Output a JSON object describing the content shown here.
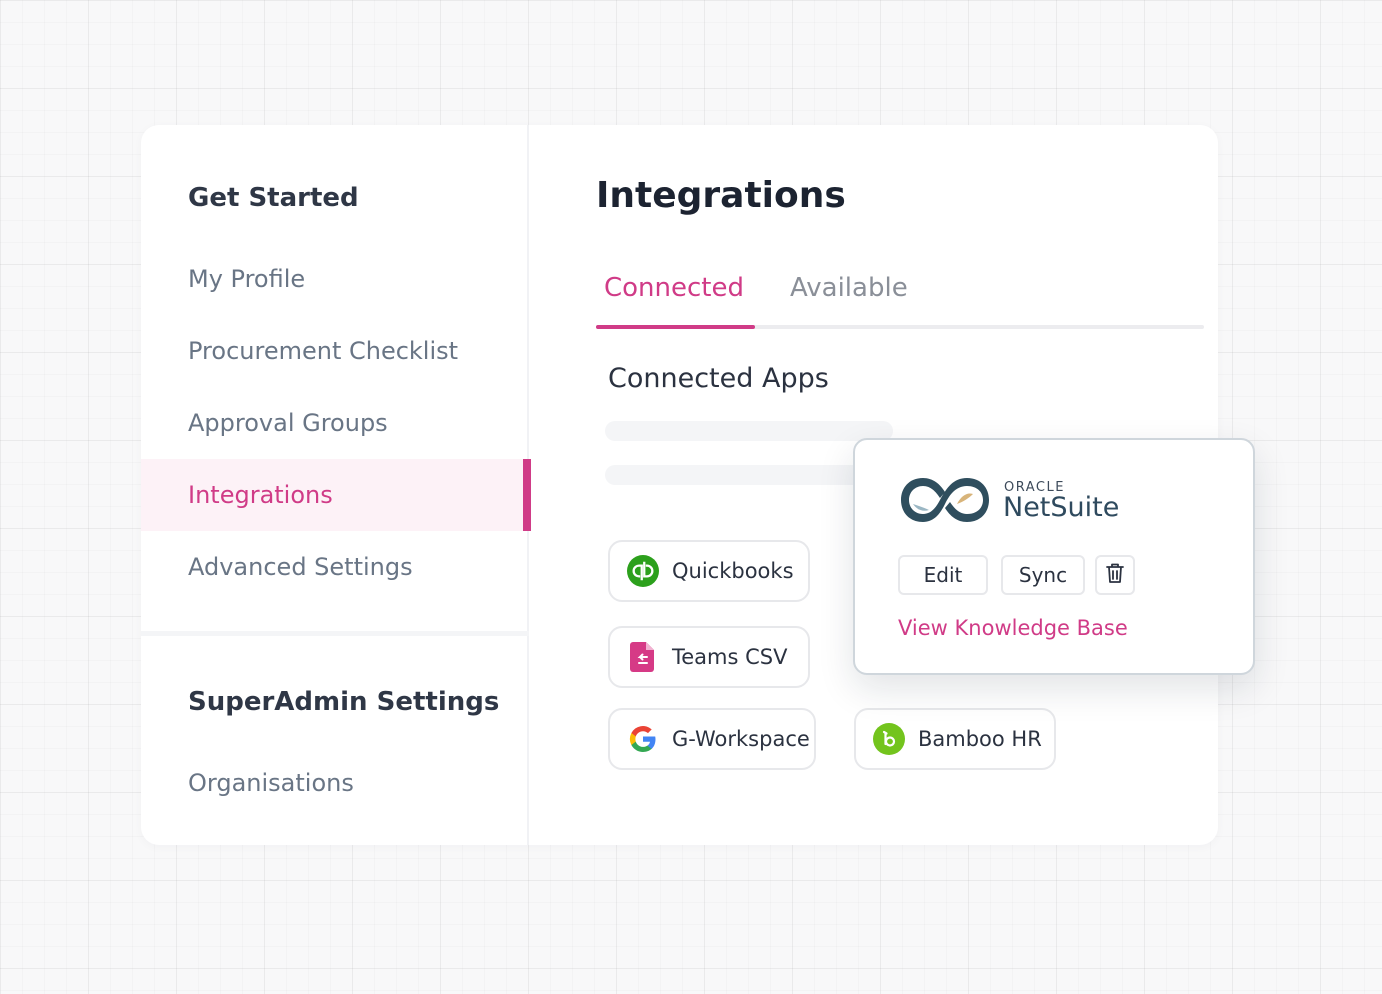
{
  "sidebar": {
    "heading": "Get Started",
    "items": [
      {
        "label": "My Profile"
      },
      {
        "label": "Procurement Checklist"
      },
      {
        "label": "Approval Groups"
      },
      {
        "label": "Integrations",
        "active": true
      },
      {
        "label": "Advanced Settings"
      }
    ],
    "admin_heading": "SuperAdmin Settings",
    "admin_items": [
      {
        "label": "Organisations"
      }
    ]
  },
  "main": {
    "title": "Integrations",
    "tabs": [
      {
        "label": "Connected",
        "active": true
      },
      {
        "label": "Available"
      }
    ],
    "section_title": "Connected Apps",
    "apps": [
      {
        "label": "Quickbooks",
        "icon": "quickbooks-icon"
      },
      {
        "label": "Teams CSV",
        "icon": "csv-file-icon"
      },
      {
        "label": "G-Workspace",
        "icon": "google-icon"
      },
      {
        "label": "Bamboo HR",
        "icon": "bamboohr-icon"
      }
    ]
  },
  "popup": {
    "brand_small": "ORACLE",
    "brand_large": "NetSuite",
    "edit_label": "Edit",
    "sync_label": "Sync",
    "delete_icon": "trash-icon",
    "link_label": "View Knowledge Base"
  },
  "colors": {
    "accent": "#d03b87",
    "active_bg": "#fdf2f7",
    "heading": "#2f3746",
    "muted": "#697585"
  }
}
